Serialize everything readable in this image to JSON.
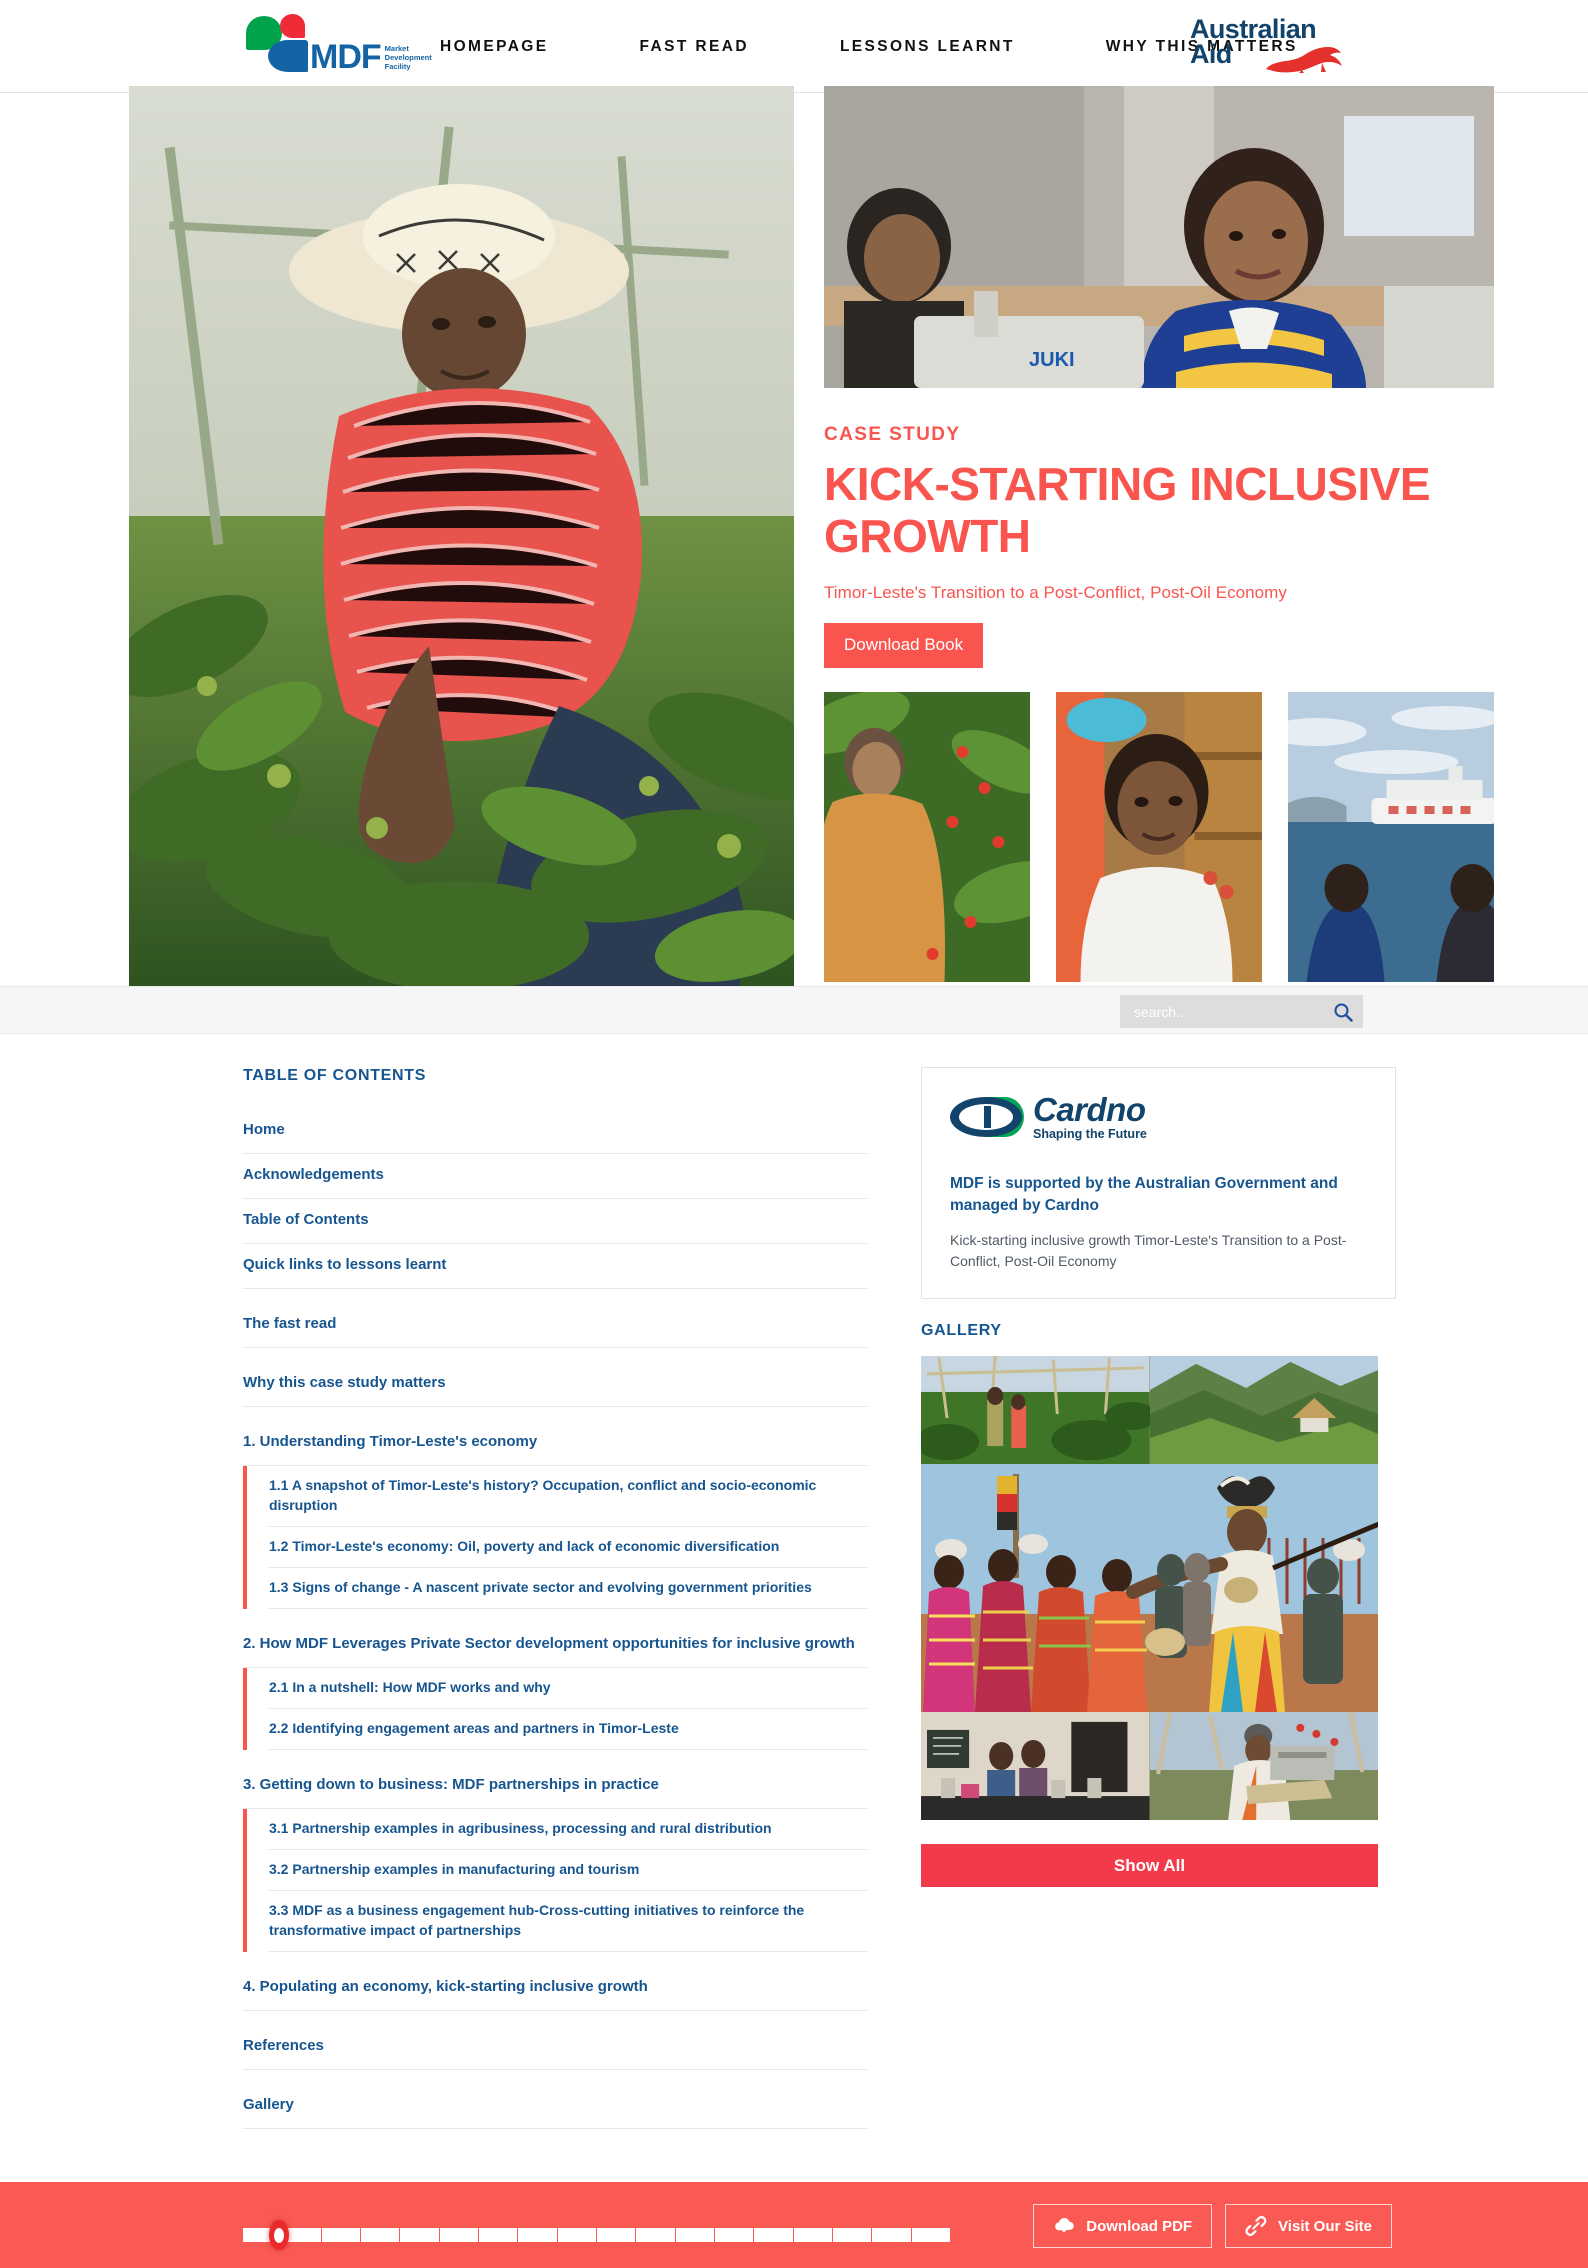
{
  "header": {
    "logo_text": "MDF",
    "logo_sub": "Market Development Facility",
    "nav": [
      {
        "label": "HOMEPAGE"
      },
      {
        "label": "FAST READ"
      },
      {
        "label": "LESSONS LEARNT"
      },
      {
        "label": "WHY THIS MATTERS"
      }
    ],
    "partner_logo_line1": "Australian",
    "partner_logo_line2": "Aid"
  },
  "hero": {
    "kicker": "CASE STUDY",
    "title": "KICK-STARTING INCLUSIVE GROWTH",
    "subtitle": "Timor-Leste's Transition to a Post-Conflict, Post-Oil Economy",
    "download_button": "Download Book"
  },
  "search": {
    "placeholder": "search..",
    "value": ""
  },
  "toc": {
    "heading": "TABLE OF CONTENTS",
    "items": [
      {
        "label": "Home",
        "children": []
      },
      {
        "label": "Acknowledgements",
        "children": []
      },
      {
        "label": "Table of Contents",
        "children": []
      },
      {
        "label": "Quick links to lessons learnt",
        "children": []
      },
      {
        "label": "The fast read",
        "children": []
      },
      {
        "label": "Why this case study matters",
        "children": []
      },
      {
        "label": "1. Understanding Timor-Leste's economy",
        "children": [
          {
            "label": "1.1 A snapshot of Timor-Leste's history? Occupation, conflict and socio-economic disruption"
          },
          {
            "label": "1.2 Timor-Leste's economy: Oil, poverty and lack of economic diversification"
          },
          {
            "label": "1.3 Signs of change - A nascent private sector and evolving government priorities"
          }
        ]
      },
      {
        "label": "2. How MDF Leverages Private Sector development opportunities for inclusive growth",
        "children": [
          {
            "label": "2.1 In a nutshell: How MDF works and why"
          },
          {
            "label": "2.2 Identifying engagement areas and partners in Timor-Leste"
          }
        ]
      },
      {
        "label": "3. Getting down to business: MDF partnerships in practice",
        "children": [
          {
            "label": "3.1 Partnership examples in agribusiness, processing and rural distribution"
          },
          {
            "label": "3.2 Partnership examples in manufacturing and tourism"
          },
          {
            "label": "3.3 MDF as a business engagement hub-Cross-cutting initiatives to reinforce the transformative impact of partnerships"
          }
        ]
      },
      {
        "label": "4. Populating an economy, kick-starting inclusive growth",
        "children": []
      },
      {
        "label": "References",
        "children": []
      },
      {
        "label": "Gallery",
        "children": []
      }
    ]
  },
  "sidebar": {
    "cardno_word": "Cardno",
    "cardno_tagline": "Shaping the Future",
    "card_title": "MDF is supported by the Australian Government and managed by Cardno",
    "card_desc": "Kick-starting inclusive growth Timor-Leste's Transition to a Post-Conflict, Post-Oil Economy",
    "gallery_heading": "GALLERY",
    "show_all_label": "Show All"
  },
  "footer": {
    "download_pdf_label": "Download PDF",
    "visit_site_label": "Visit Our Site",
    "progress_ticks": 18,
    "progress_position_percent": 4
  },
  "colors": {
    "accent_red": "#f9544e",
    "brand_blue": "#16558f",
    "footer_red": "#fb5a54",
    "show_all_red": "#f23a4a",
    "cardno_green": "#00a651"
  }
}
